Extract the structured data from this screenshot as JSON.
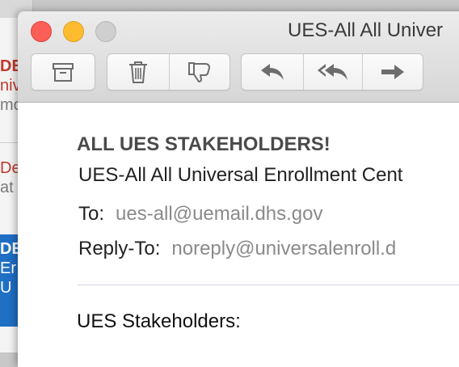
{
  "window": {
    "title": "UES-All All Univer"
  },
  "toolbar": {
    "buttons": [
      "archive-button",
      "delete-button",
      "junk-button",
      "reply-button",
      "reply-all-button",
      "forward-button"
    ]
  },
  "background_list": {
    "rows": [
      {
        "l1": "DE",
        "l2": "niv",
        "l3": "mo"
      },
      {
        "l1": "",
        "l2": "De",
        "l3": "at"
      },
      {
        "l1": "DE",
        "l2": "Er",
        "l3": "U"
      }
    ]
  },
  "message": {
    "subject": "ALL UES STAKEHOLDERS!",
    "from": "UES-All All Universal Enrollment Cent",
    "to_label": "To:",
    "to_value": "ues-all@uemail.dhs.gov",
    "reply_to_label": "Reply-To:",
    "reply_to_value": "noreply@universalenroll.d",
    "greeting": "UES Stakeholders:"
  }
}
